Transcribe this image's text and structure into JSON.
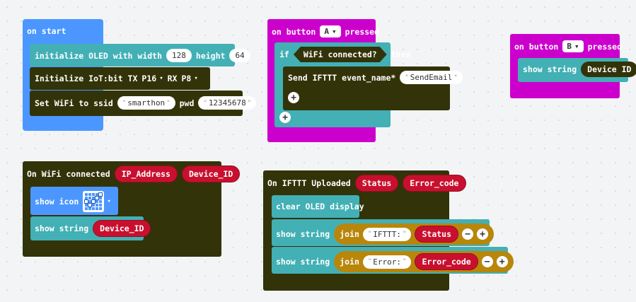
{
  "on_start": {
    "title": "on start",
    "oled_label": "initialize OLED with width",
    "oled_width": "128",
    "oled_height_label": "height",
    "oled_height": "64",
    "iot_label": "Initialize IoT:bit TX",
    "tx_pin": "P16",
    "rx_label": "RX",
    "rx_pin": "P8",
    "wifi_label": "Set WiFi to ssid",
    "ssid": "smarthon",
    "pwd_label": "pwd",
    "pwd": "12345678"
  },
  "button_a": {
    "title_pre": "on button",
    "button": "A",
    "title_post": "pressed",
    "if_label": "if",
    "condition": "WiFi connected?",
    "then_label": "then",
    "send_label": "Send IFTTT event_name*",
    "event_name": "SendEmail"
  },
  "button_b": {
    "title_pre": "on button",
    "button": "B",
    "title_post": "pressed",
    "show_label": "show string",
    "value": "Device ID"
  },
  "wifi_connected": {
    "title": "On WiFi connected",
    "param1": "IP_Address",
    "param2": "Device_ID",
    "show_icon_label": "show icon",
    "show_string_label": "show string",
    "string_var": "Device_ID"
  },
  "ifttt_uploaded": {
    "title": "On IFTTT Uploaded",
    "param1": "Status",
    "param2": "Error_code",
    "clear_label": "clear OLED display",
    "show1_label": "show string",
    "join1_label": "join",
    "join1_text": "IFTTT: ",
    "join1_var": "Status",
    "show2_label": "show string",
    "join2_label": "join",
    "join2_text": "Error: ",
    "join2_var": "Error_code"
  },
  "icons": {
    "dropdown": "▾",
    "plus": "+",
    "minus": "−"
  },
  "colors": {
    "basic_blue": "#4c97ff",
    "teal": "#42b0b5",
    "iot_dark": "#333309",
    "input_magenta": "#cc00cc",
    "variable_red": "#c8102e",
    "text_gold": "#b8860b"
  }
}
